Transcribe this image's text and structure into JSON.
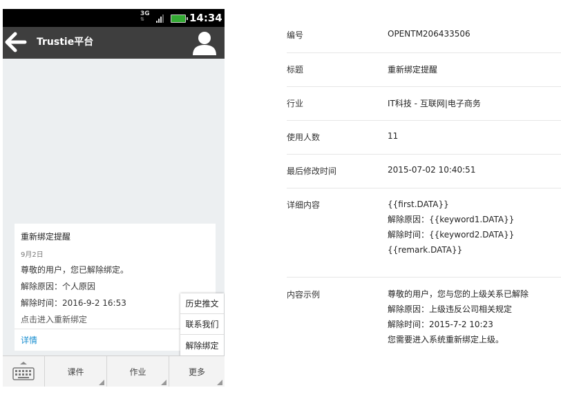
{
  "status_bar": {
    "network": "3G",
    "time": "14:34"
  },
  "title_bar": {
    "title": "Trustie平台",
    "back_icon": "arrow-left-icon",
    "profile_icon": "person-icon"
  },
  "message": {
    "title": "重新绑定提醒",
    "date": "9月2日",
    "greeting": "尊敬的用户，您已解除绑定。",
    "reason": "解除原因：个人原因",
    "time": "解除时间：2016-9-2 16:53",
    "link": "点击进入重新绑定",
    "detail_link": "详情",
    "link_color": "#1a8fd0"
  },
  "popup_menu": {
    "items": [
      "历史推文",
      "联系我们",
      "解除绑定"
    ]
  },
  "bottom_bar": {
    "keyboard_icon": "keyboard-icon",
    "items": [
      "课件",
      "作业",
      "更多"
    ]
  },
  "details": {
    "rows": [
      {
        "label": "编号",
        "lines": [
          "OPENTM206433506"
        ]
      },
      {
        "label": "标题",
        "lines": [
          "重新绑定提醒"
        ]
      },
      {
        "label": "行业",
        "lines": [
          "IT科技 - 互联网|电子商务"
        ]
      },
      {
        "label": "使用人数",
        "lines": [
          "11"
        ]
      },
      {
        "label": "最后修改时间",
        "lines": [
          "2015-07-02 10:40:51"
        ]
      },
      {
        "label": "详细内容",
        "lines": [
          "{{first.DATA}}",
          "解除原因：{{keyword1.DATA}}",
          "解除时间：{{keyword2.DATA}}",
          "{{remark.DATA}}"
        ]
      },
      {
        "label": "内容示例",
        "lines": [
          "尊敬的用户，您与您的上级关系已解除",
          "解除原因：上级违反公司相关规定",
          "解除时间：2015-7-2 10:23",
          "您需要进入系统重新绑定上级。"
        ]
      }
    ]
  }
}
